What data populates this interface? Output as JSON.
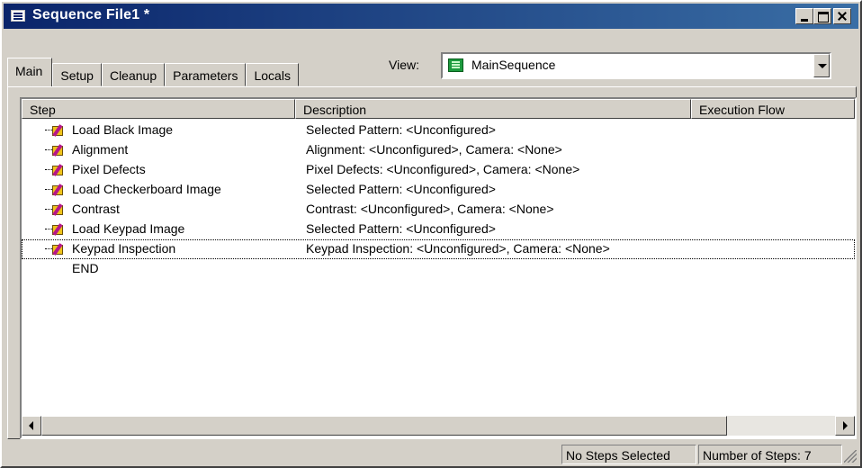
{
  "window": {
    "title": "Sequence File1 *"
  },
  "tabs": [
    {
      "label": "Main"
    },
    {
      "label": "Setup"
    },
    {
      "label": "Cleanup"
    },
    {
      "label": "Parameters"
    },
    {
      "label": "Locals"
    }
  ],
  "view": {
    "label": "View:",
    "value": "MainSequence"
  },
  "columns": {
    "step": "Step",
    "description": "Description",
    "execution_flow": "Execution Flow"
  },
  "steps": [
    {
      "name": "Load Black Image",
      "description": "Selected Pattern: <Unconfigured>"
    },
    {
      "name": "Alignment",
      "description": "Alignment: <Unconfigured>, Camera: <None>"
    },
    {
      "name": "Pixel Defects",
      "description": "Pixel Defects: <Unconfigured>, Camera: <None>"
    },
    {
      "name": "Load Checkerboard Image",
      "description": "Selected Pattern: <Unconfigured>"
    },
    {
      "name": "Contrast",
      "description": "Contrast: <Unconfigured>, Camera: <None>"
    },
    {
      "name": "Load Keypad Image",
      "description": "Selected Pattern: <Unconfigured>"
    },
    {
      "name": "Keypad Inspection",
      "description": "Keypad Inspection: <Unconfigured>, Camera: <None>"
    }
  ],
  "end_label": "END",
  "status": {
    "selection": "No Steps Selected",
    "count": "Number of Steps: 7"
  },
  "colors": {
    "titlebar_start": "#0a246a",
    "titlebar_end": "#3a6ea5",
    "face": "#d4d0c8"
  }
}
